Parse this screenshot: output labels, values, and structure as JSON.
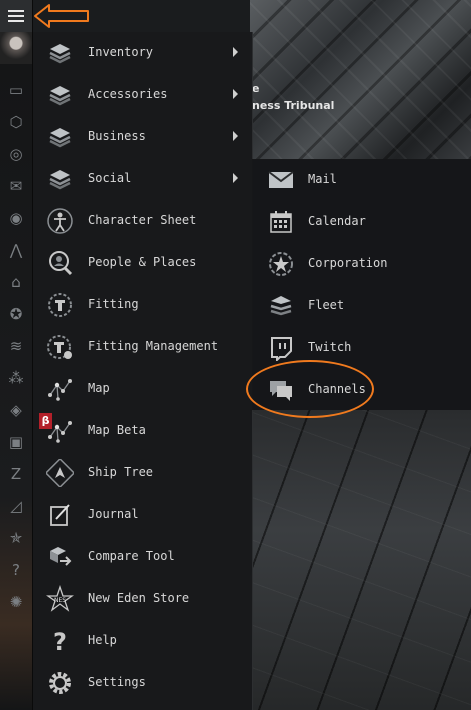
{
  "scene": {
    "text_top": "e",
    "text_bottom": "ness Tribunal"
  },
  "rail": {
    "icons": [
      {
        "name": "chat-icon",
        "glyph": "▭"
      },
      {
        "name": "box-icon",
        "glyph": "⬡"
      },
      {
        "name": "search-person-icon",
        "glyph": "◎"
      },
      {
        "name": "mail-icon",
        "glyph": "✉"
      },
      {
        "name": "coin-icon",
        "glyph": "◉"
      },
      {
        "name": "chart-icon",
        "glyph": "⋀"
      },
      {
        "name": "factory-icon",
        "glyph": "⌂"
      },
      {
        "name": "star-badge-icon",
        "glyph": "✪"
      },
      {
        "name": "layers-icon",
        "glyph": "≋"
      },
      {
        "name": "map-beta-icon",
        "glyph": "⁂"
      },
      {
        "name": "ship-icon",
        "glyph": "◈"
      },
      {
        "name": "window-icon",
        "glyph": "▣"
      },
      {
        "name": "z-icon",
        "glyph": "Z"
      },
      {
        "name": "journal-icon",
        "glyph": "◿"
      },
      {
        "name": "nes-star-icon",
        "glyph": "✯"
      },
      {
        "name": "help-icon",
        "glyph": "?"
      },
      {
        "name": "gear-icon",
        "glyph": "✺"
      }
    ],
    "beta_label": "β"
  },
  "menu": {
    "items": [
      {
        "label": "Inventory",
        "icon": "stack-icon",
        "submenu": true
      },
      {
        "label": "Accessories",
        "icon": "stack-icon",
        "submenu": true
      },
      {
        "label": "Business",
        "icon": "stack-icon",
        "submenu": true
      },
      {
        "label": "Social",
        "icon": "stack-icon",
        "submenu": true
      },
      {
        "label": "Character Sheet",
        "icon": "character-icon",
        "submenu": false
      },
      {
        "label": "People & Places",
        "icon": "people-icon",
        "submenu": false
      },
      {
        "label": "Fitting",
        "icon": "fitting-icon",
        "submenu": false
      },
      {
        "label": "Fitting Management",
        "icon": "fitting-management-icon",
        "submenu": false
      },
      {
        "label": "Map",
        "icon": "map-icon",
        "submenu": false
      },
      {
        "label": "Map Beta",
        "icon": "map-icon",
        "submenu": false,
        "beta": "β"
      },
      {
        "label": "Ship Tree",
        "icon": "ship-tree-icon",
        "submenu": false
      },
      {
        "label": "Journal",
        "icon": "journal-icon",
        "submenu": false
      },
      {
        "label": "Compare Tool",
        "icon": "compare-icon",
        "submenu": false
      },
      {
        "label": "New Eden Store",
        "icon": "nes-icon",
        "submenu": false
      },
      {
        "label": "Help",
        "icon": "help-icon",
        "submenu": false
      },
      {
        "label": "Settings",
        "icon": "gear-icon",
        "submenu": false
      }
    ]
  },
  "submenu": {
    "items": [
      {
        "label": "Mail",
        "icon": "mail-icon"
      },
      {
        "label": "Calendar",
        "icon": "calendar-icon"
      },
      {
        "label": "Corporation",
        "icon": "corporation-icon"
      },
      {
        "label": "Fleet",
        "icon": "fleet-icon"
      },
      {
        "label": "Twitch",
        "icon": "twitch-icon"
      },
      {
        "label": "Channels",
        "icon": "channels-icon"
      }
    ]
  },
  "colors": {
    "annotation": "#f07a1e",
    "beta": "#b3202a"
  }
}
